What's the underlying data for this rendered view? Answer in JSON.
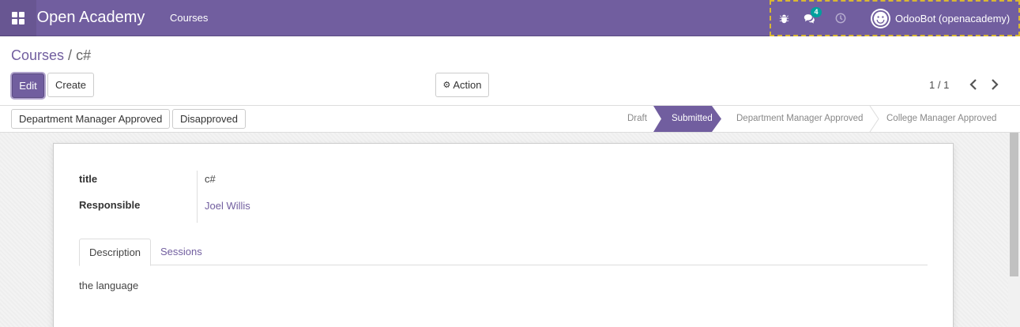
{
  "navbar": {
    "app_name": "Open Academy",
    "menu_courses": "Courses",
    "messages_count": "4",
    "user_name": "OdooBot (openacademy)"
  },
  "breadcrumb": {
    "parent": "Courses",
    "separator": "/",
    "current": "c#"
  },
  "control_panel": {
    "edit_label": "Edit",
    "create_label": "Create",
    "action_label": "Action",
    "pager_text": "1 / 1"
  },
  "statusbar": {
    "buttons": [
      "Department Manager Approved",
      "Disapproved"
    ],
    "stages": [
      "Draft",
      "Submitted",
      "Department Manager Approved",
      "College Manager Approved"
    ],
    "active_stage": "Submitted"
  },
  "form": {
    "title_label": "title",
    "title_value": "c#",
    "responsible_label": "Responsible",
    "responsible_value": "Joel Willis",
    "tabs": [
      "Description",
      "Sessions"
    ],
    "description_text": "the language"
  },
  "colors": {
    "brand": "#715e9f",
    "badge": "#00a09d",
    "highlight_border": "#d9b733"
  }
}
